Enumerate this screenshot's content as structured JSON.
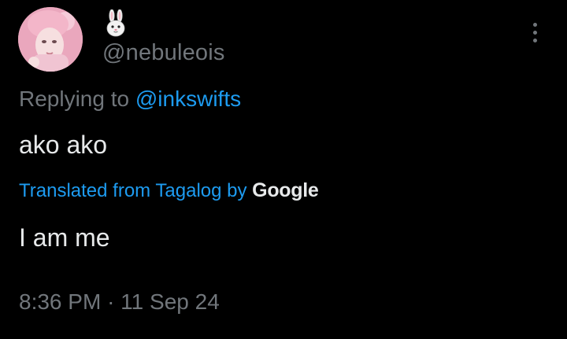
{
  "tweet": {
    "author": {
      "display_name_icon": "rabbit-face-emoji",
      "handle": "@nebuleois"
    },
    "replying_to_prefix": "Replying to",
    "replying_to_handle": "@inkswifts",
    "text": "ako ako",
    "translation": {
      "label": "Translated from Tagalog by",
      "provider": "Google",
      "text": "I am me"
    },
    "time": "8:36 PM",
    "separator": "·",
    "date": "11 Sep 24"
  },
  "colors": {
    "background": "#000000",
    "primary_text": "#e7e9ea",
    "secondary_text": "#71767b",
    "accent": "#1d9bf0"
  },
  "icons": {
    "more": "more-vertical-icon",
    "display_name": "rabbit-icon"
  }
}
